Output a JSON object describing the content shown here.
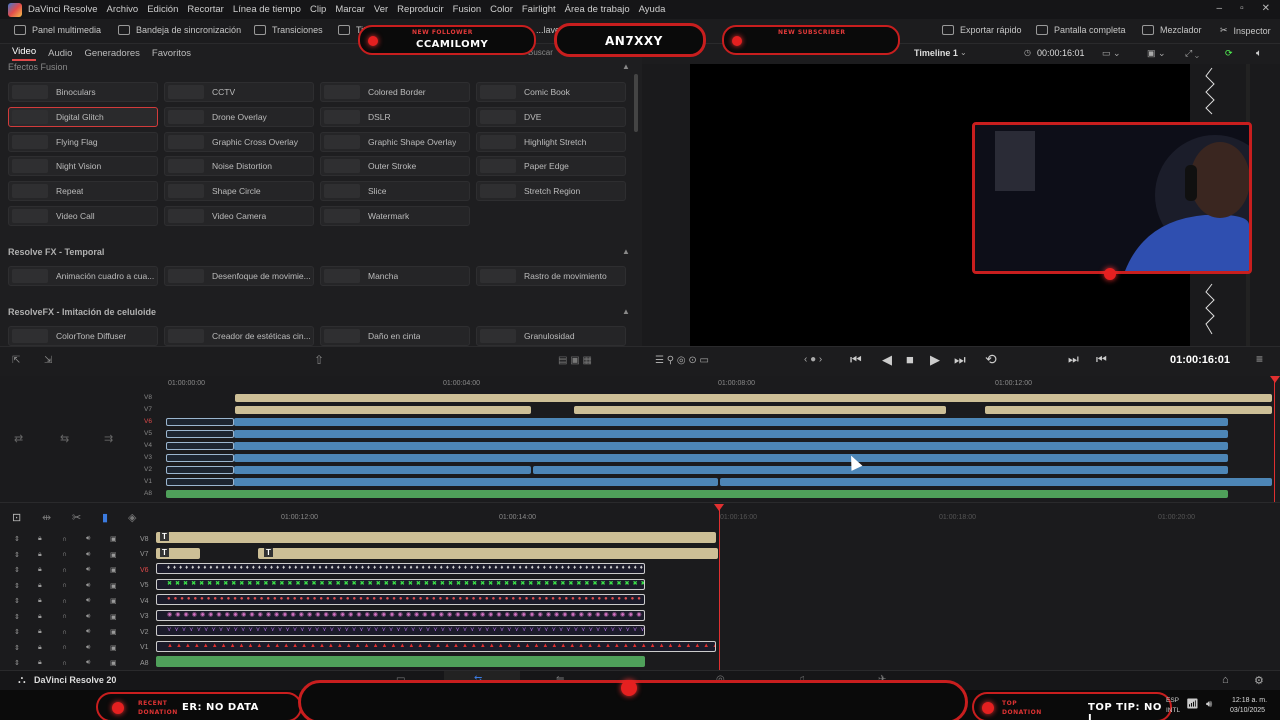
{
  "menubar": {
    "app_title": "DaVinci Resolve",
    "items": [
      "Archivo",
      "Edición",
      "Recortar",
      "Línea de tiempo",
      "Clip",
      "Marcar",
      "Ver",
      "Reproducir",
      "Fusion",
      "Color",
      "Fairlight",
      "Área de trabajo",
      "Ayuda"
    ]
  },
  "toolbar": {
    "media_pool": "Panel multimedia",
    "sync_bin": "Bandeja de sincronización",
    "transitions": "Transiciones",
    "titles": "Tit...",
    "keyframes": "...lave",
    "quick_export": "Exportar rápido",
    "fullscreen": "Pantalla completa",
    "mixer": "Mezclador",
    "inspector": "Inspector"
  },
  "fx_tabs": [
    "Video",
    "Audio",
    "Generadores",
    "Favoritos"
  ],
  "fx_search": "Buscar",
  "sections": {
    "fusion": "Efectos Fusion",
    "temporal": "Resolve FX - Temporal",
    "film": "ResolveFX - Imitación de celuloide"
  },
  "fusion_effects": [
    "Binoculars",
    "CCTV",
    "Colored Border",
    "Comic Book",
    "Digital Glitch",
    "Drone Overlay",
    "DSLR",
    "DVE",
    "Flying Flag",
    "Graphic Cross Overlay",
    "Graphic Shape Overlay",
    "Highlight Stretch",
    "Night Vision",
    "Noise Distortion",
    "Outer Stroke",
    "Paper Edge",
    "Repeat",
    "Shape Circle",
    "Slice",
    "Stretch Region",
    "Video Call",
    "Video Camera",
    "Watermark"
  ],
  "temporal_effects": [
    "Animación cuadro a cua...",
    "Desenfoque de movimie...",
    "Mancha",
    "Rastro de movimiento"
  ],
  "film_effects": [
    "ColorTone Diffuser",
    "Creador de estéticas cin...",
    "Daño en cinta",
    "Granulosidad"
  ],
  "viewer": {
    "timeline_name": "Timeline 1",
    "timecode_top": "00:00:16:01",
    "timecode_transport": "01:00:16:01"
  },
  "timeline1": {
    "ruler": [
      "01:00:00:00",
      "01:00:04:00",
      "01:00:08:00",
      "01:00:12:00"
    ],
    "tracks": [
      "V8",
      "V7",
      "V6",
      "V5",
      "V4",
      "V3",
      "V2",
      "V1",
      "A8"
    ]
  },
  "timeline2": {
    "ruler": [
      "01:00:12:00",
      "01:00:14:00",
      "01:00:16:00",
      "01:00:18:00",
      "01:00:20:00"
    ],
    "tracks": [
      "V8",
      "V7",
      "V6",
      "V5",
      "V4",
      "V3",
      "V2",
      "V1",
      "A8"
    ],
    "title_glyph": "T"
  },
  "footer": {
    "app_name": "DaVinci Resolve 20",
    "language": "ESP",
    "region": "INTL",
    "time": "12:18 a. m.",
    "date": "03/10/2025"
  },
  "overlay": {
    "follower_label": "NEW FOLLOWER",
    "follower_name": "CCAMILOMY",
    "channel_name": "AN7XXY",
    "subscriber_label": "NEW SUBSCRIBER",
    "recent_label": "RECENT",
    "donation_label": "DONATION",
    "recent_value": "ER: NO DATA",
    "top_label": "TOP",
    "top_tip": "TOP TIP: NO I"
  },
  "colors": {
    "accent_red": "#c81e1e",
    "clip_blue": "#4d86b6",
    "clip_tan": "#cdbf96",
    "clip_green": "#4fa05a"
  }
}
